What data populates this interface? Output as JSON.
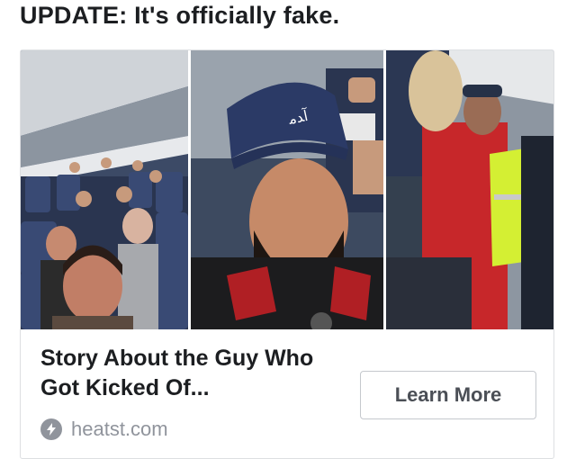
{
  "update_headline": "UPDATE: It's officially fake.",
  "ad": {
    "title": "Story About the Guy Who Got Kicked Of...",
    "source_domain": "heatst.com",
    "cta_label": "Learn More",
    "images": [
      {
        "subject": "airplane-cabin-passengers"
      },
      {
        "subject": "man-in-cap-selfie"
      },
      {
        "subject": "woman-escorted-by-officer"
      }
    ]
  },
  "colors": {
    "text_primary": "#1c1e21",
    "text_secondary": "#90949c",
    "button_border": "#c5c8cd",
    "card_border": "#dddfe2"
  }
}
